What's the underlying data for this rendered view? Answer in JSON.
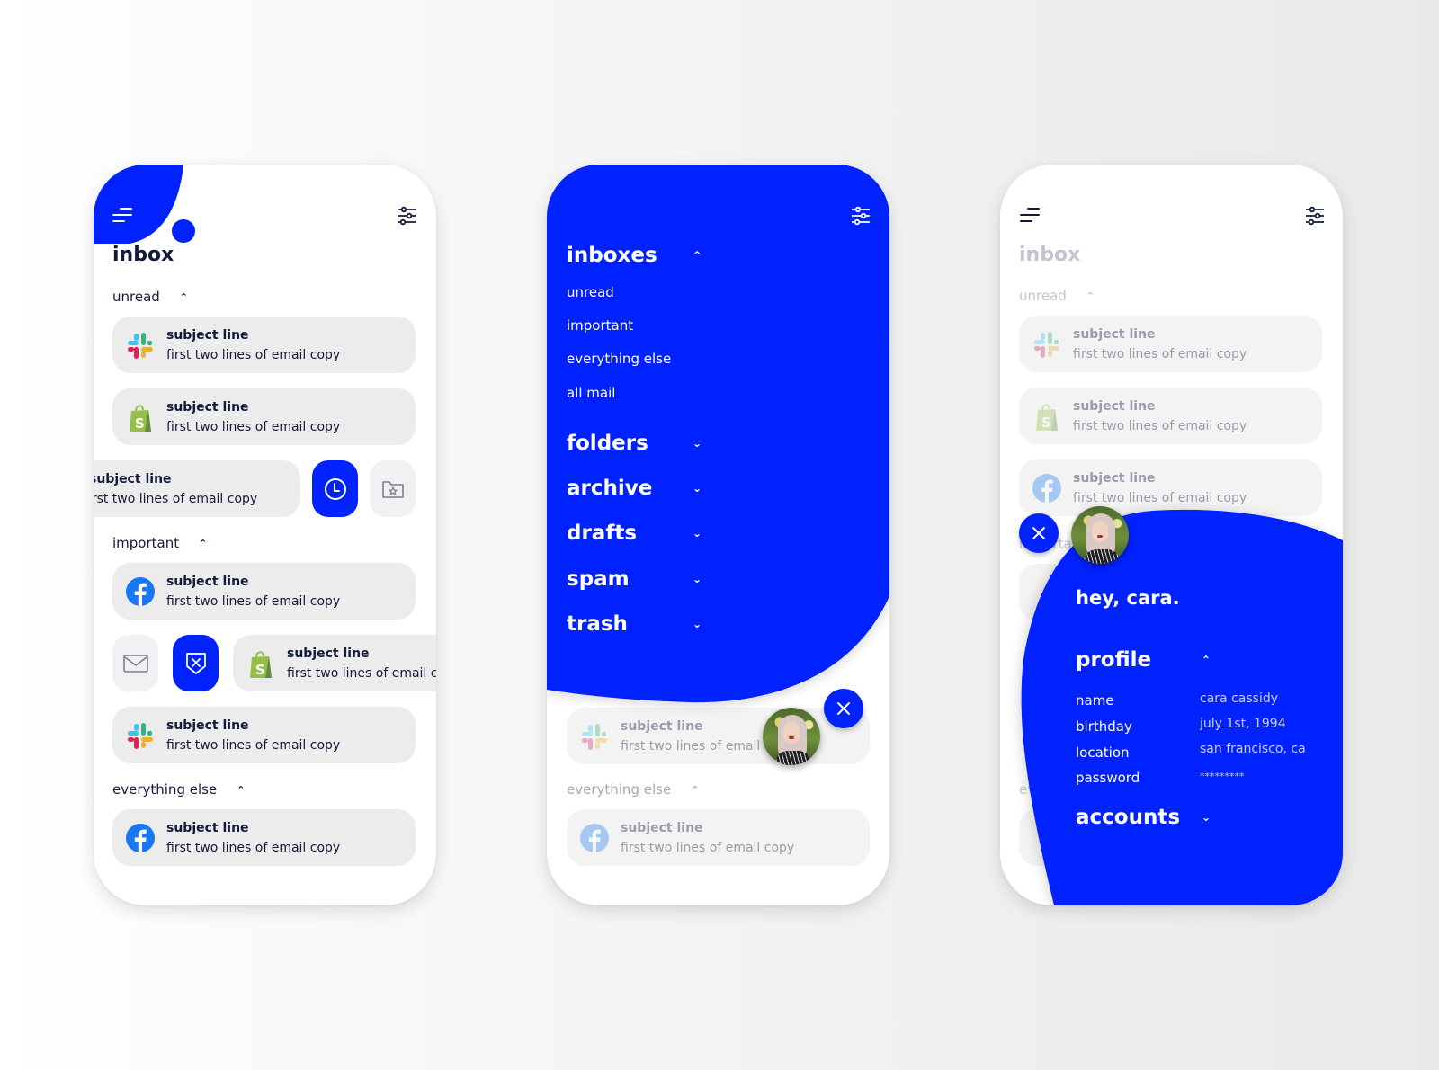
{
  "brand_color": "#0022ff",
  "email_preview": {
    "subject": "subject line",
    "copy": "first two lines of email copy"
  },
  "screen1": {
    "title": "inbox",
    "sections": [
      {
        "label": "unread",
        "expanded": true
      },
      {
        "label": "important",
        "expanded": true
      },
      {
        "label": "everything else",
        "expanded": true
      }
    ],
    "emails": [
      {
        "sender_icon": "slack-icon",
        "section": "unread"
      },
      {
        "sender_icon": "shopify-icon",
        "section": "unread"
      },
      {
        "sender_icon": "none",
        "section": "unread",
        "swiped": "left",
        "actions": [
          "snooze-clock-icon",
          "folder-star-icon"
        ]
      },
      {
        "sender_icon": "facebook-icon",
        "section": "important"
      },
      {
        "sender_icon": "shopify-icon",
        "section": "important",
        "swiped": "right",
        "actions": [
          "mail-icon",
          "block-shield-icon"
        ]
      },
      {
        "sender_icon": "slack-icon",
        "section": "important"
      },
      {
        "sender_icon": "facebook-icon",
        "section": "everything else"
      }
    ]
  },
  "screen2": {
    "menu": {
      "groups": [
        {
          "label": "inboxes",
          "expanded": true,
          "items": [
            "unread",
            "important",
            "everything else",
            "all mail"
          ]
        },
        {
          "label": "folders",
          "expanded": false
        },
        {
          "label": "archive",
          "expanded": false
        },
        {
          "label": "drafts",
          "expanded": false
        },
        {
          "label": "spam",
          "expanded": false
        },
        {
          "label": "trash",
          "expanded": false
        }
      ]
    },
    "background_section": "everything else"
  },
  "screen3": {
    "title": "inbox",
    "section": "unread",
    "hidden_sections": [
      "important",
      "everything else"
    ],
    "greeting": "hey, cara.",
    "profile": {
      "heading": "profile",
      "expanded": true,
      "fields": [
        {
          "label": "name",
          "value": "cara cassidy"
        },
        {
          "label": "birthday",
          "value": "july 1st, 1994"
        },
        {
          "label": "location",
          "value": "san francisco, ca"
        },
        {
          "label": "password",
          "value": "*********"
        }
      ]
    },
    "accounts": {
      "heading": "accounts",
      "expanded": false
    }
  }
}
